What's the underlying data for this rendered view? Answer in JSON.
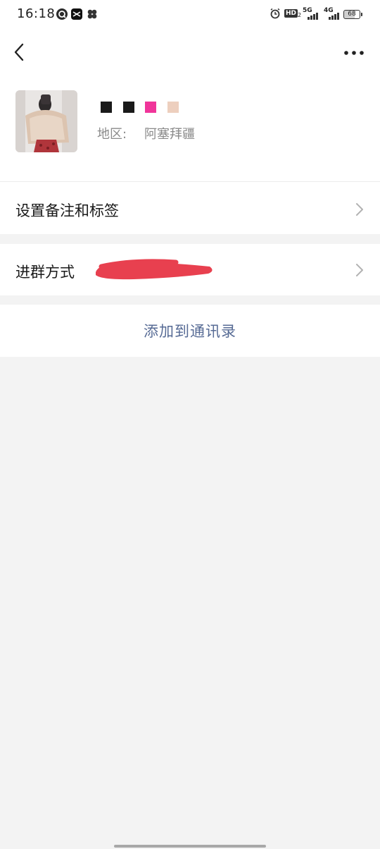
{
  "status_bar": {
    "time": "16:18",
    "hd": "HD",
    "hd_sub": "2",
    "net1": "5G",
    "net2": "4G",
    "battery": "68"
  },
  "nav": {
    "back_icon": "chevron-left-icon",
    "more_icon": "more-dots-icon"
  },
  "profile": {
    "name_squares": [
      "#1a1a1a",
      "#1a1a1a",
      "#f0359a",
      "#edcfbe"
    ],
    "region_label": "地区:",
    "region_value": "阿塞拜疆"
  },
  "rows": {
    "remark_label": "设置备注和标签",
    "join_label": "进群方式"
  },
  "actions": {
    "add_label": "添加到通讯录"
  },
  "colors": {
    "link": "#576b95",
    "redaction": "#e8404f",
    "background": "#f3f3f3"
  }
}
